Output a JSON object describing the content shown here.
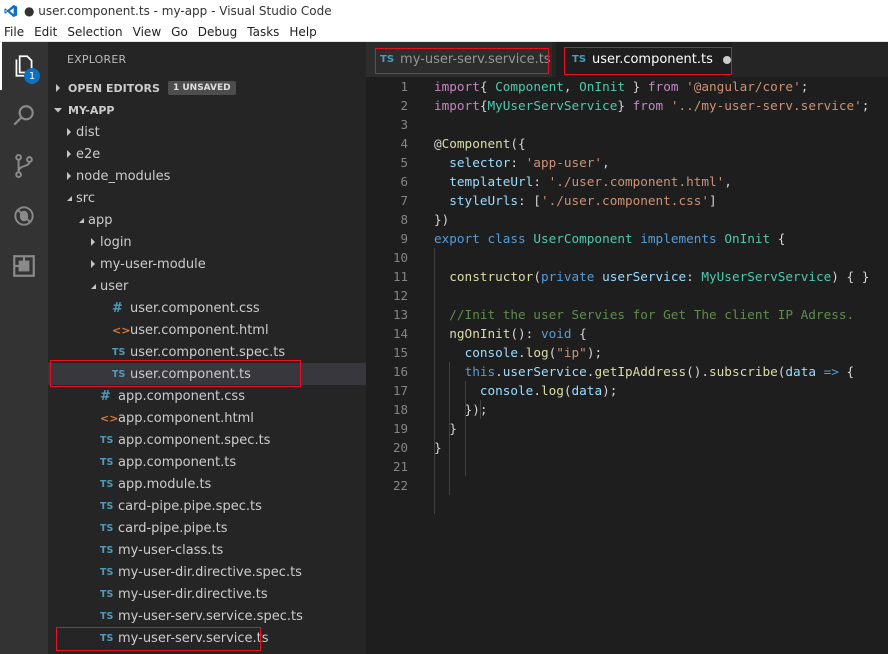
{
  "window": {
    "title": "● user.component.ts - my-app - Visual Studio Code"
  },
  "menu": [
    "File",
    "Edit",
    "Selection",
    "View",
    "Go",
    "Debug",
    "Tasks",
    "Help"
  ],
  "activity_bar": {
    "items": [
      "explorer-icon",
      "search-icon",
      "source-control-icon",
      "debug-icon",
      "extensions-icon"
    ],
    "explorer_badge": "1"
  },
  "sidebar": {
    "title": "EXPLORER",
    "open_editors": {
      "label": "OPEN EDITORS",
      "badge": "1 UNSAVED"
    },
    "project": {
      "label": "MY-APP"
    },
    "tree": [
      {
        "label": "dist",
        "kind": "folder",
        "expanded": false,
        "depth": 0
      },
      {
        "label": "e2e",
        "kind": "folder",
        "expanded": false,
        "depth": 0
      },
      {
        "label": "node_modules",
        "kind": "folder",
        "expanded": false,
        "depth": 0
      },
      {
        "label": "src",
        "kind": "folder",
        "expanded": true,
        "depth": 0
      },
      {
        "label": "app",
        "kind": "folder",
        "expanded": true,
        "depth": 1
      },
      {
        "label": "login",
        "kind": "folder",
        "expanded": false,
        "depth": 2
      },
      {
        "label": "my-user-module",
        "kind": "folder",
        "expanded": false,
        "depth": 2
      },
      {
        "label": "user",
        "kind": "folder",
        "expanded": true,
        "depth": 2
      },
      {
        "label": "user.component.css",
        "kind": "css",
        "depth": 3
      },
      {
        "label": "user.component.html",
        "kind": "html",
        "depth": 3
      },
      {
        "label": "user.component.spec.ts",
        "kind": "ts",
        "depth": 3
      },
      {
        "label": "user.component.ts",
        "kind": "ts",
        "depth": 3,
        "selected": true
      },
      {
        "label": "app.component.css",
        "kind": "css",
        "depth": 2
      },
      {
        "label": "app.component.html",
        "kind": "html",
        "depth": 2
      },
      {
        "label": "app.component.spec.ts",
        "kind": "ts",
        "depth": 2
      },
      {
        "label": "app.component.ts",
        "kind": "ts",
        "depth": 2
      },
      {
        "label": "app.module.ts",
        "kind": "ts",
        "depth": 2
      },
      {
        "label": "card-pipe.pipe.spec.ts",
        "kind": "ts",
        "depth": 2
      },
      {
        "label": "card-pipe.pipe.ts",
        "kind": "ts",
        "depth": 2
      },
      {
        "label": "my-user-class.ts",
        "kind": "ts",
        "depth": 2
      },
      {
        "label": "my-user-dir.directive.spec.ts",
        "kind": "ts",
        "depth": 2
      },
      {
        "label": "my-user-dir.directive.ts",
        "kind": "ts",
        "depth": 2
      },
      {
        "label": "my-user-serv.service.spec.ts",
        "kind": "ts",
        "depth": 2
      },
      {
        "label": "my-user-serv.service.ts",
        "kind": "ts",
        "depth": 2
      }
    ]
  },
  "icons": {
    "ts": "TS",
    "css": "#",
    "html": "<>"
  },
  "tabs": [
    {
      "label": "my-user-serv.service.ts",
      "active": false,
      "dirty": false
    },
    {
      "label": "user.component.ts",
      "active": true,
      "dirty": true
    }
  ],
  "editor": {
    "line_numbers": [
      "1",
      "2",
      "3",
      "4",
      "5",
      "6",
      "7",
      "8",
      "9",
      "10",
      "11",
      "12",
      "13",
      "14",
      "15",
      "16",
      "17",
      "18",
      "19",
      "20",
      "21",
      "22"
    ],
    "lines": [
      [
        [
          "kw2",
          "import"
        ],
        [
          "",
          "{ "
        ],
        [
          "ty",
          "Component"
        ],
        [
          "",
          ", "
        ],
        [
          "ty",
          "OnInit"
        ],
        [
          "",
          " } "
        ],
        [
          "kw2",
          "from"
        ],
        [
          "",
          " "
        ],
        [
          "str",
          "'@angular/core'"
        ],
        [
          "",
          ";"
        ]
      ],
      [
        [
          "kw2",
          "import"
        ],
        [
          "",
          "{"
        ],
        [
          "ty",
          "MyUserServService"
        ],
        [
          "",
          "} "
        ],
        [
          "kw2",
          "from"
        ],
        [
          "",
          " "
        ],
        [
          "str",
          "'../my-user-serv.service'"
        ],
        [
          "",
          ";"
        ]
      ],
      [],
      [
        [
          "",
          "@"
        ],
        [
          "fn",
          "Component"
        ],
        [
          "",
          "({"
        ]
      ],
      [
        [
          "",
          "  "
        ],
        [
          "var",
          "selector"
        ],
        [
          "",
          ": "
        ],
        [
          "str",
          "'app-user'"
        ],
        [
          "",
          ","
        ]
      ],
      [
        [
          "",
          "  "
        ],
        [
          "var",
          "templateUrl"
        ],
        [
          "",
          ": "
        ],
        [
          "str",
          "'./user.component.html'"
        ],
        [
          "",
          ","
        ]
      ],
      [
        [
          "",
          "  "
        ],
        [
          "var",
          "styleUrls"
        ],
        [
          "",
          ": ["
        ],
        [
          "str",
          "'./user.component.css'"
        ],
        [
          "",
          "]"
        ]
      ],
      [
        [
          "",
          "})"
        ]
      ],
      [
        [
          "kw",
          "export"
        ],
        [
          "",
          " "
        ],
        [
          "kw",
          "class"
        ],
        [
          "",
          " "
        ],
        [
          "ty",
          "UserComponent"
        ],
        [
          "",
          " "
        ],
        [
          "kw",
          "implements"
        ],
        [
          "",
          " "
        ],
        [
          "ty",
          "OnInit"
        ],
        [
          "",
          " {"
        ]
      ],
      [],
      [
        [
          "",
          "  "
        ],
        [
          "fn",
          "constructor"
        ],
        [
          "",
          "("
        ],
        [
          "kw",
          "private"
        ],
        [
          "",
          " "
        ],
        [
          "var",
          "userService"
        ],
        [
          "",
          ": "
        ],
        [
          "ty",
          "MyUserServService"
        ],
        [
          "",
          ") { }"
        ]
      ],
      [],
      [
        [
          "",
          "  "
        ],
        [
          "cm",
          "//Init the user Servies for Get The client IP Adress."
        ]
      ],
      [
        [
          "",
          "  "
        ],
        [
          "fn",
          "ngOnInit"
        ],
        [
          "",
          "(): "
        ],
        [
          "kw",
          "void"
        ],
        [
          "",
          " {"
        ]
      ],
      [
        [
          "",
          "    "
        ],
        [
          "var",
          "console"
        ],
        [
          "",
          "."
        ],
        [
          "fn",
          "log"
        ],
        [
          "",
          "("
        ],
        [
          "str",
          "\"ip\""
        ],
        [
          "",
          ");"
        ]
      ],
      [
        [
          "",
          "    "
        ],
        [
          "kw",
          "this"
        ],
        [
          "",
          "."
        ],
        [
          "var",
          "userService"
        ],
        [
          "",
          "."
        ],
        [
          "fn",
          "getIpAddress"
        ],
        [
          "",
          "()."
        ],
        [
          "fn",
          "subscribe"
        ],
        [
          "",
          "("
        ],
        [
          "var",
          "data"
        ],
        [
          "",
          " "
        ],
        [
          "kw",
          "=>"
        ],
        [
          "",
          " {"
        ]
      ],
      [
        [
          "",
          "      "
        ],
        [
          "var",
          "console"
        ],
        [
          "",
          "."
        ],
        [
          "fn",
          "log"
        ],
        [
          "",
          "("
        ],
        [
          "var",
          "data"
        ],
        [
          "",
          ");"
        ]
      ],
      [
        [
          "",
          "    "
        ],
        [
          "",
          "});"
        ]
      ],
      [
        [
          "",
          "  "
        ],
        [
          "",
          "}"
        ]
      ],
      [
        [
          "",
          "}"
        ]
      ],
      [],
      []
    ]
  }
}
